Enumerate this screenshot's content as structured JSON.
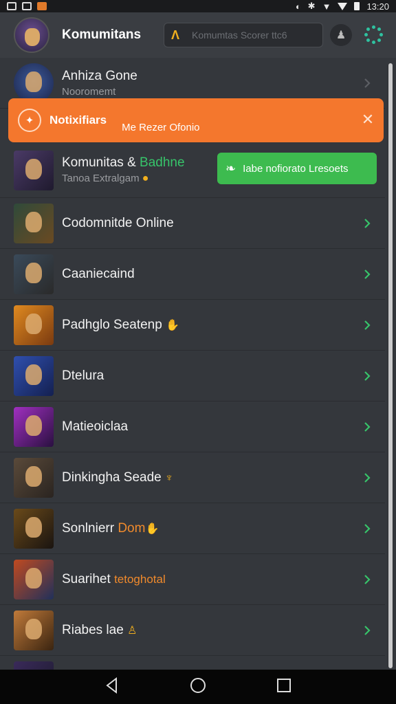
{
  "status_bar": {
    "time": "13:20"
  },
  "header": {
    "title": "Komumitans",
    "search_placeholder": "Komumtas Scorer ttc6"
  },
  "notification": {
    "title": "Notixifiars",
    "message": "Me Rezer Ofonio",
    "close": "✕"
  },
  "action_button": {
    "label": "Iabe nofiorato Lresoets"
  },
  "rows": [
    {
      "title": "Anhiza Gone",
      "subtitle": "Nooromemt"
    },
    {
      "title": "Komunitas",
      "title_amp": "&",
      "title_accent": "Badhne",
      "subtitle": "Tanoa Extralgam"
    },
    {
      "title": "Codomnitde Online"
    },
    {
      "title": "Caaniecaind"
    },
    {
      "title": "Padhglo Seatenp"
    },
    {
      "title": "Dtelura"
    },
    {
      "title": "Matieoiclaa"
    },
    {
      "title": "Dinkingha Seade"
    },
    {
      "title": "Sonlnierr",
      "title_accent": "Dom"
    },
    {
      "title": "Suarihet",
      "title_accent": "tetoghotal"
    },
    {
      "title": "Riabes lae"
    }
  ],
  "colors": {
    "notification": "#f4772d",
    "action_green": "#3dbb4f",
    "chevron_green": "#37c46a",
    "accent_orange": "#f08a2c"
  }
}
